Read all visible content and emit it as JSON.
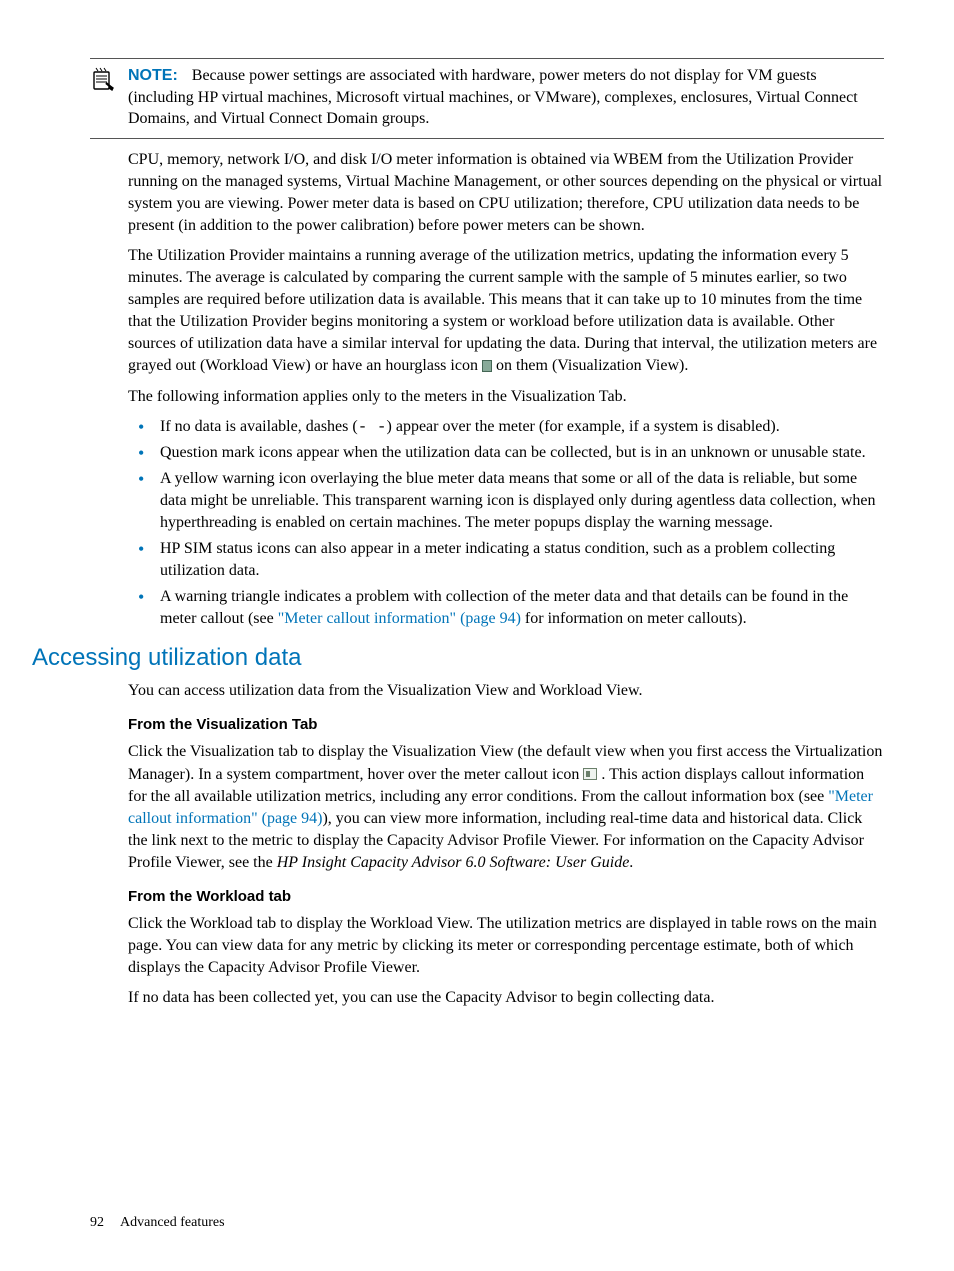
{
  "note": {
    "label": "NOTE:",
    "text": "Because power settings are associated with hardware, power meters do not display for VM guests (including HP virtual machines, Microsoft virtual machines, or VMware), complexes, enclosures, Virtual Connect Domains, and Virtual Connect Domain groups."
  },
  "p1": "CPU, memory, network I/O, and disk I/O meter information is obtained via WBEM from the Utilization Provider running on the managed systems, Virtual Machine Management, or other sources depending on the physical or virtual system you are viewing. Power meter data is based on CPU utilization; therefore, CPU utilization data needs to be present (in addition to the power calibration) before power meters can be shown.",
  "p2a": "The Utilization Provider maintains a running average of the utilization metrics, updating the information every 5 minutes. The average is calculated by comparing the current sample with the sample of 5 minutes earlier, so two samples are required before utilization data is available. This means that it can take up to 10 minutes from the time that the Utilization Provider begins monitoring a system or workload before utilization data is available. Other sources of utilization data have a similar interval for updating the data. During that interval, the utilization meters are grayed out (Workload View) or have an hourglass icon ",
  "p2b": " on them (Visualization View).",
  "p3": "The following information applies only to the meters in the Visualization Tab.",
  "bullets": [
    {
      "pre": "If no data is available, dashes (",
      "code": "-  -",
      "post": ") appear over the meter (for example, if a system is disabled)."
    },
    {
      "text": "Question mark icons appear when the utilization data can be collected, but is in an unknown or unusable state."
    },
    {
      "text": "A yellow warning icon overlaying the blue meter data means that some or all of the data is reliable, but some data might be unreliable. This transparent warning icon is displayed only during agentless data collection, when hyperthreading is enabled on certain machines. The meter popups display the warning message."
    },
    {
      "text": "HP SIM status icons can also appear in a meter indicating a status condition, such as a problem collecting utilization data."
    },
    {
      "pre2": "A warning triangle indicates a problem with collection of the meter data and that details can be found in the meter callout (see ",
      "link": "\"Meter callout information\" (page 94)",
      "post2": " for information on meter callouts)."
    }
  ],
  "h2": "Accessing utilization data",
  "p4": "You can access utilization data from the Visualization View and Workload View.",
  "h3a": "From the Visualization Tab",
  "p5a": "Click the Visualization tab to display the Visualization View (the default view when you first access the Virtualization Manager). In a system compartment, hover over the meter callout icon ",
  "p5b": " . This action displays callout information for the all available utilization metrics, including any error conditions. From the callout information box (see ",
  "p5link": "\"Meter callout information\" (page 94)",
  "p5c": "), you can view more information, including real-time data and historical data. Click the link next to the metric to display the Capacity Advisor Profile Viewer. For information on the Capacity Advisor Profile Viewer, see the ",
  "p5ital": "HP Insight Capacity Advisor 6.0 Software: User Guide",
  "p5d": ".",
  "h3b": "From the Workload tab",
  "p6": "Click the Workload tab to display the Workload View. The utilization metrics are displayed in table rows on the main page. You can view data for any metric by clicking its meter or corresponding percentage estimate, both of which displays the Capacity Advisor Profile Viewer.",
  "p7": "If no data has been collected yet, you can use the Capacity Advisor to begin collecting data.",
  "footer": {
    "page": "92",
    "section": "Advanced features"
  }
}
